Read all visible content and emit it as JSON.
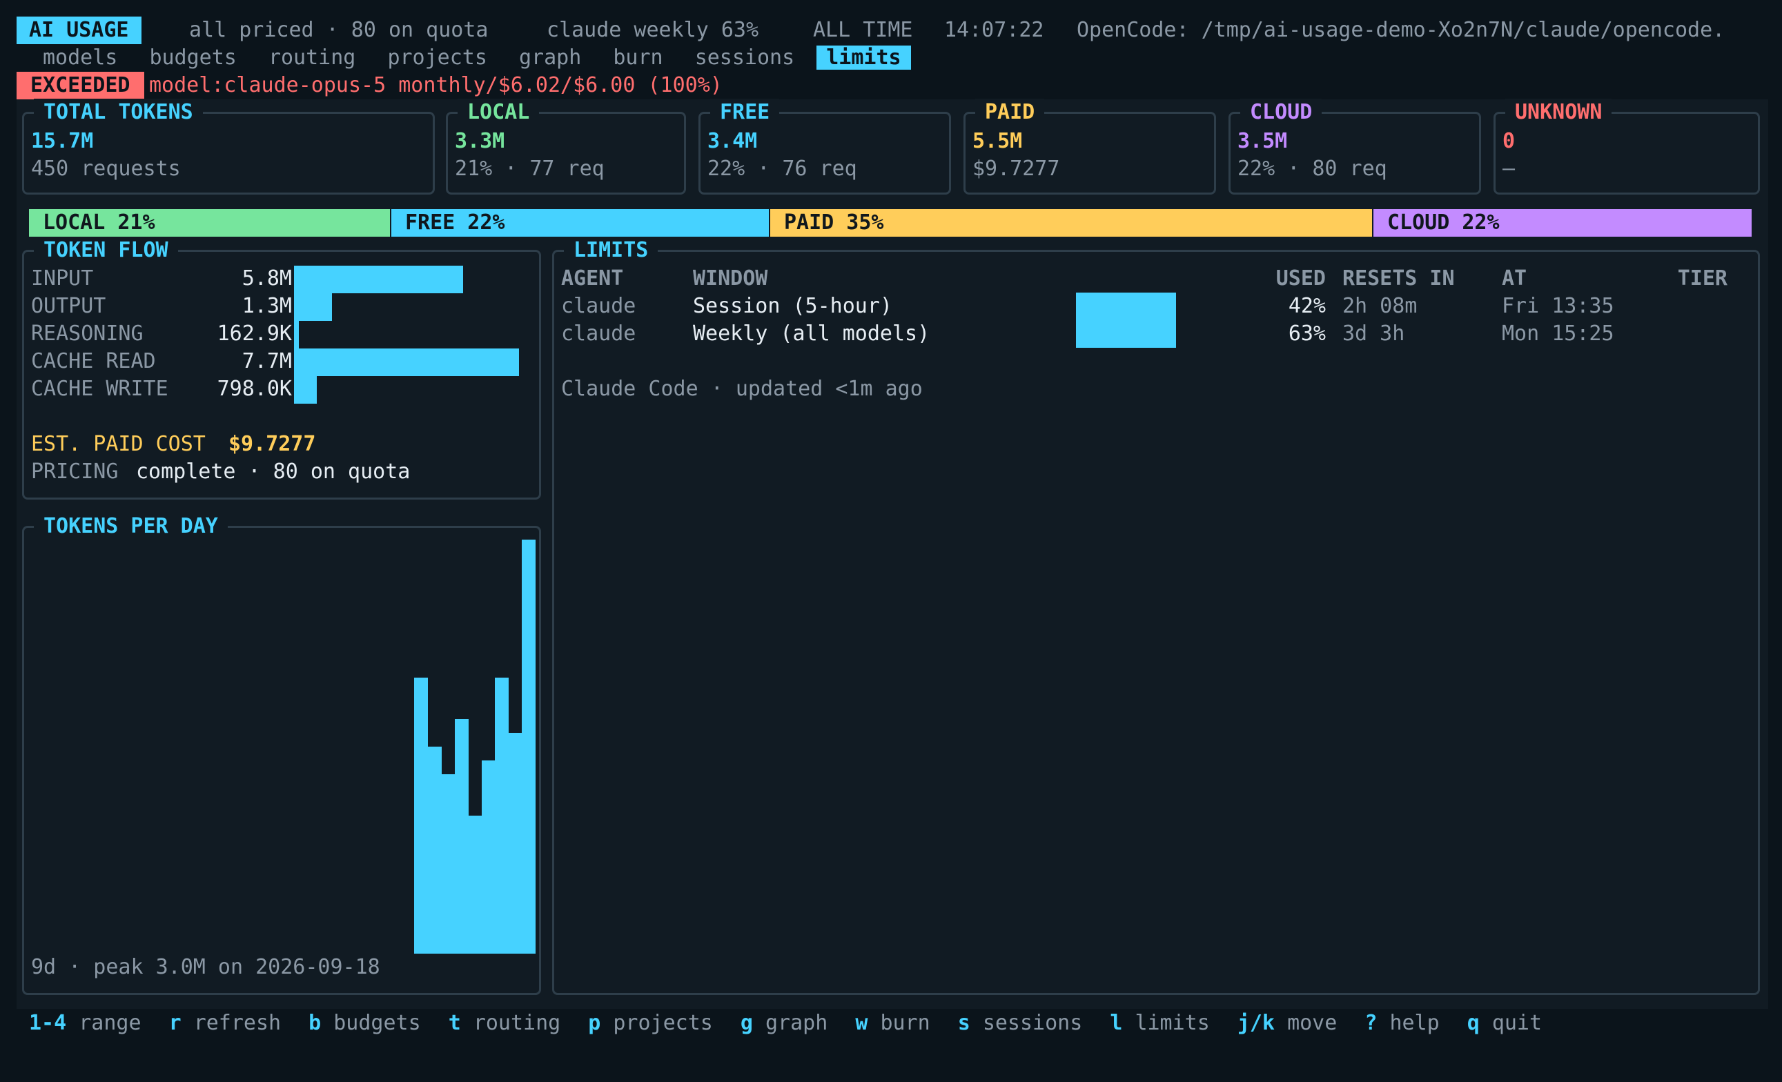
{
  "header": {
    "app_badge": "AI USAGE",
    "pricing_status": "all priced · 80 on quota",
    "weekly_status": "claude weekly 63%",
    "range": "ALL TIME",
    "clock": "14:07:22",
    "source": "OpenCode: /tmp/ai-usage-demo-Xo2n7N/claude/opencode."
  },
  "tabs": [
    {
      "label": "models"
    },
    {
      "label": "budgets"
    },
    {
      "label": "routing"
    },
    {
      "label": "projects"
    },
    {
      "label": "graph"
    },
    {
      "label": "burn"
    },
    {
      "label": "sessions"
    },
    {
      "label": "limits",
      "active": true
    }
  ],
  "alert": {
    "badge": "EXCEEDED",
    "message": "model:claude-opus-5 monthly/$6.02/$6.00 (100%)"
  },
  "stats": {
    "total": {
      "title": "TOTAL TOKENS",
      "value": "15.7M",
      "sub": "450 requests"
    },
    "local": {
      "title": "LOCAL",
      "value": "3.3M",
      "sub": "21% · 77 req"
    },
    "free": {
      "title": "FREE",
      "value": "3.4M",
      "sub": "22% · 76 req"
    },
    "paid": {
      "title": "PAID",
      "value": "5.5M",
      "sub": "$9.7277"
    },
    "cloud": {
      "title": "CLOUD",
      "value": "3.5M",
      "sub": "22% · 80 req"
    },
    "unknown": {
      "title": "UNKNOWN",
      "value": "0",
      "sub": "—"
    }
  },
  "split_bar": [
    {
      "label": "LOCAL 21%",
      "fraction": 0.21,
      "color": "#76e59d"
    },
    {
      "label": "FREE 22%",
      "fraction": 0.22,
      "color": "#46d2ff"
    },
    {
      "label": "PAID 35%",
      "fraction": 0.35,
      "color": "#ffcd5a"
    },
    {
      "label": "CLOUD 22%",
      "fraction": 0.22,
      "color": "#c38bff"
    }
  ],
  "token_flow": {
    "title": "TOKEN FLOW",
    "rows": [
      {
        "label": "INPUT",
        "value": "5.8M",
        "fraction": 0.75
      },
      {
        "label": "OUTPUT",
        "value": "1.3M",
        "fraction": 0.17
      },
      {
        "label": "REASONING",
        "value": "162.9K",
        "fraction": 0.02
      },
      {
        "label": "CACHE READ",
        "value": "7.7M",
        "fraction": 1.0
      },
      {
        "label": "CACHE WRITE",
        "value": "798.0K",
        "fraction": 0.1
      }
    ],
    "cost_label": "EST. PAID COST",
    "cost_value": "$9.7277",
    "pricing_label": "PRICING",
    "pricing_value": "complete · 80 on quota"
  },
  "tokens_per_day": {
    "title": "TOKENS PER DAY",
    "footer": "9d · peak 3.0M on 2026-09-18",
    "values_m": [
      2.0,
      1.5,
      1.3,
      1.7,
      1.0,
      1.4,
      2.0,
      1.6,
      3.0
    ]
  },
  "limits": {
    "title": "LIMITS",
    "columns": {
      "agent": "AGENT",
      "window": "WINDOW",
      "used": "USED",
      "resets": "RESETS IN",
      "at": "AT",
      "tier": "TIER"
    },
    "rows": [
      {
        "agent": "claude",
        "window": "Session (5-hour)",
        "used": "42%",
        "used_fraction": 0.42,
        "resets": "2h 08m",
        "at": "Fri 13:35",
        "tier": ""
      },
      {
        "agent": "claude",
        "window": "Weekly (all models)",
        "used": "63%",
        "used_fraction": 0.63,
        "resets": "3d 3h",
        "at": "Mon 15:25",
        "tier": ""
      }
    ],
    "note": "Claude Code · updated <1m ago"
  },
  "shortcuts": [
    {
      "key": "1-4",
      "label": "range"
    },
    {
      "key": "r",
      "label": "refresh"
    },
    {
      "key": "b",
      "label": "budgets"
    },
    {
      "key": "t",
      "label": "routing"
    },
    {
      "key": "p",
      "label": "projects"
    },
    {
      "key": "g",
      "label": "graph"
    },
    {
      "key": "w",
      "label": "burn"
    },
    {
      "key": "s",
      "label": "sessions"
    },
    {
      "key": "l",
      "label": "limits"
    },
    {
      "key": "j/k",
      "label": "move"
    },
    {
      "key": "?",
      "label": "help"
    },
    {
      "key": "q",
      "label": "quit"
    }
  ]
}
